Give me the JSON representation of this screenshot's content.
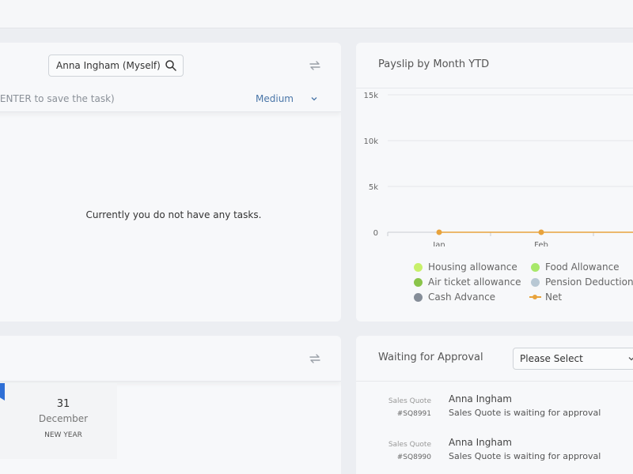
{
  "tasks": {
    "assignee": "Anna Ingham (Myself)",
    "hint": ": ENTER to save the task)",
    "priority": "Medium",
    "empty_message": "Currently you do not have any tasks."
  },
  "payslip": {
    "title": "Payslip by Month YTD",
    "legend": [
      {
        "label": "Housing allowance",
        "color": "#c8f06a"
      },
      {
        "label": "Food Allowance",
        "color": "#a8e86a"
      },
      {
        "label": "Air ticket allowance",
        "color": "#8ac44a"
      },
      {
        "label": "Pension Deduction",
        "color": "#b8c8d4"
      },
      {
        "label": "Cash Advance",
        "color": "#858d98"
      },
      {
        "label": "Net",
        "color": "#e8a33c"
      }
    ]
  },
  "chart_data": {
    "type": "line",
    "categories": [
      "Jan",
      "Feb"
    ],
    "y_ticks": [
      "15k",
      "10k",
      "5k",
      "0"
    ],
    "ylim": [
      0,
      15000
    ],
    "series": [
      {
        "name": "Net",
        "values": [
          0,
          0
        ],
        "color": "#e8a33c"
      }
    ]
  },
  "events": {
    "day": "31",
    "month": "December",
    "name": "NEW YEAR",
    "flag_color": "#2f6fd6"
  },
  "approval": {
    "title": "Waiting for Approval",
    "select_value": "Please Select",
    "rows": [
      {
        "type": "Sales Quote",
        "id": "#SQ8991",
        "name": "Anna Ingham",
        "desc": "Sales Quote is waiting for approval"
      },
      {
        "type": "Sales Quote",
        "id": "#SQ8990",
        "name": "Anna Ingham",
        "desc": "Sales Quote is waiting for approval"
      }
    ]
  }
}
